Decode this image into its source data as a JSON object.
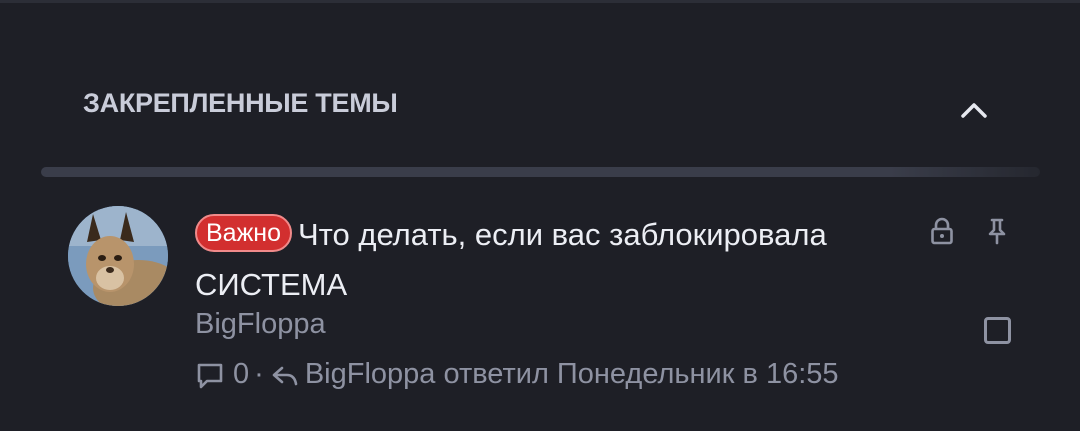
{
  "section": {
    "title": "ЗАКРЕПЛЕННЫЕ ТЕМЫ",
    "collapse_icon": "chevron-up-icon"
  },
  "thread": {
    "badge": "Важно",
    "title": "Что делать, если вас заблокировала СИСТЕМА",
    "author": "BigFloppa",
    "replies_count": "0",
    "separator": "·",
    "last_reply": "BigFloppa ответил Понедельник в 16:55",
    "icons": {
      "comment": "comment-icon",
      "reply": "reply-icon",
      "lock": "lock-icon",
      "pin": "pin-icon"
    }
  },
  "colors": {
    "background": "#1e1f26",
    "badge": "#d22f2f",
    "title_text": "#eceef4",
    "muted_text": "#8e92a2",
    "header_text": "#c9ccd9"
  }
}
